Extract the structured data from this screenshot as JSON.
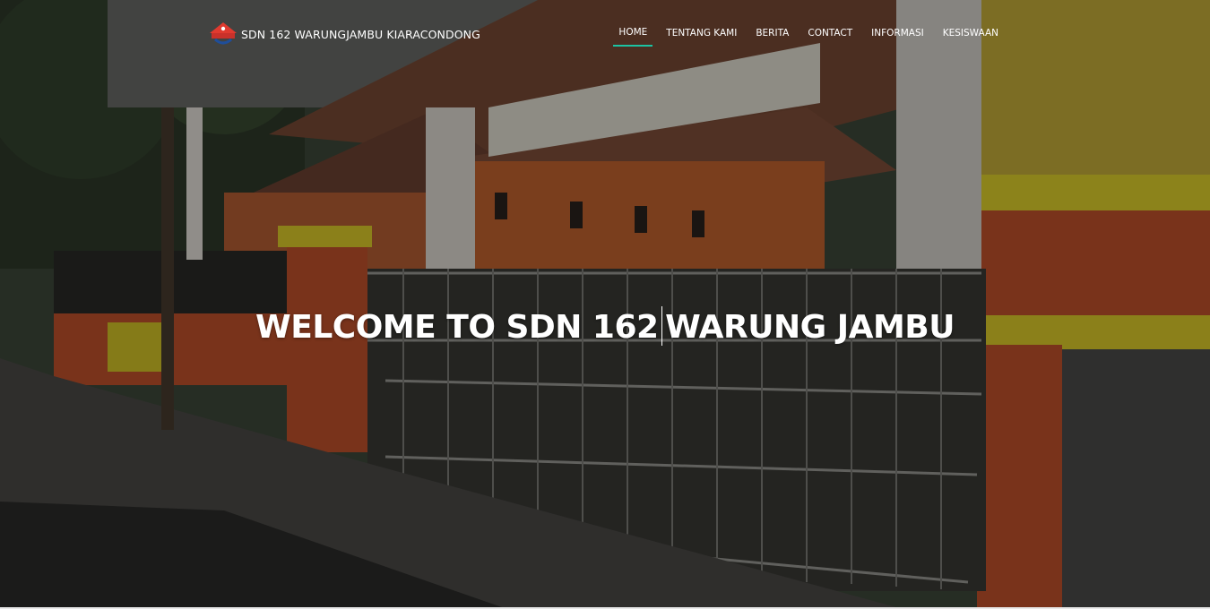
{
  "brand": {
    "name": "SDN 162 WARUNGJAMBU KIARACONDONG",
    "logo_icon": "school-emblem-icon"
  },
  "nav": {
    "items": [
      {
        "label": "HOME",
        "active": true
      },
      {
        "label": "TENTANG KAMI",
        "active": false
      },
      {
        "label": "BERITA",
        "active": false
      },
      {
        "label": "CONTACT",
        "active": false
      },
      {
        "label": "INFORMASI",
        "active": false
      },
      {
        "label": "KESISWAAN",
        "active": false
      }
    ]
  },
  "hero": {
    "title_part1": "WELCOME TO SDN 162",
    "title_part2": "WARUNG JAMBU",
    "background": "school-building-photo"
  },
  "colors": {
    "accent": "#1cc3a2",
    "text": "#ffffff",
    "wall_orange": "#c3522c",
    "wall_yellow": "#d8c21f"
  }
}
